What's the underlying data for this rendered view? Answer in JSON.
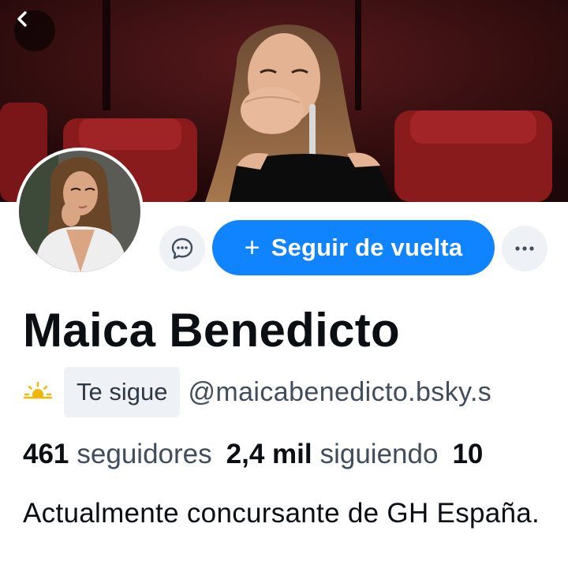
{
  "header": {
    "back_icon": "chevron-left-icon"
  },
  "actions": {
    "message_icon": "chat-bubble-icon",
    "follow_plus": "+",
    "follow_label": "Seguir de vuelta",
    "more_icon": "ellipsis-icon",
    "accent_color": "#1083fe"
  },
  "profile": {
    "display_name": "Maica Benedicto",
    "status_icon": "sun-cloud-icon",
    "follows_you": "Te sigue",
    "handle": "@maicabenedicto.bsky.s",
    "bio": "Actualmente concursante de GH España."
  },
  "stats": {
    "followers_count": "461",
    "followers_label": "seguidores",
    "following_count": "2,4 mil",
    "following_label": "siguiendo",
    "posts_count": "10"
  }
}
